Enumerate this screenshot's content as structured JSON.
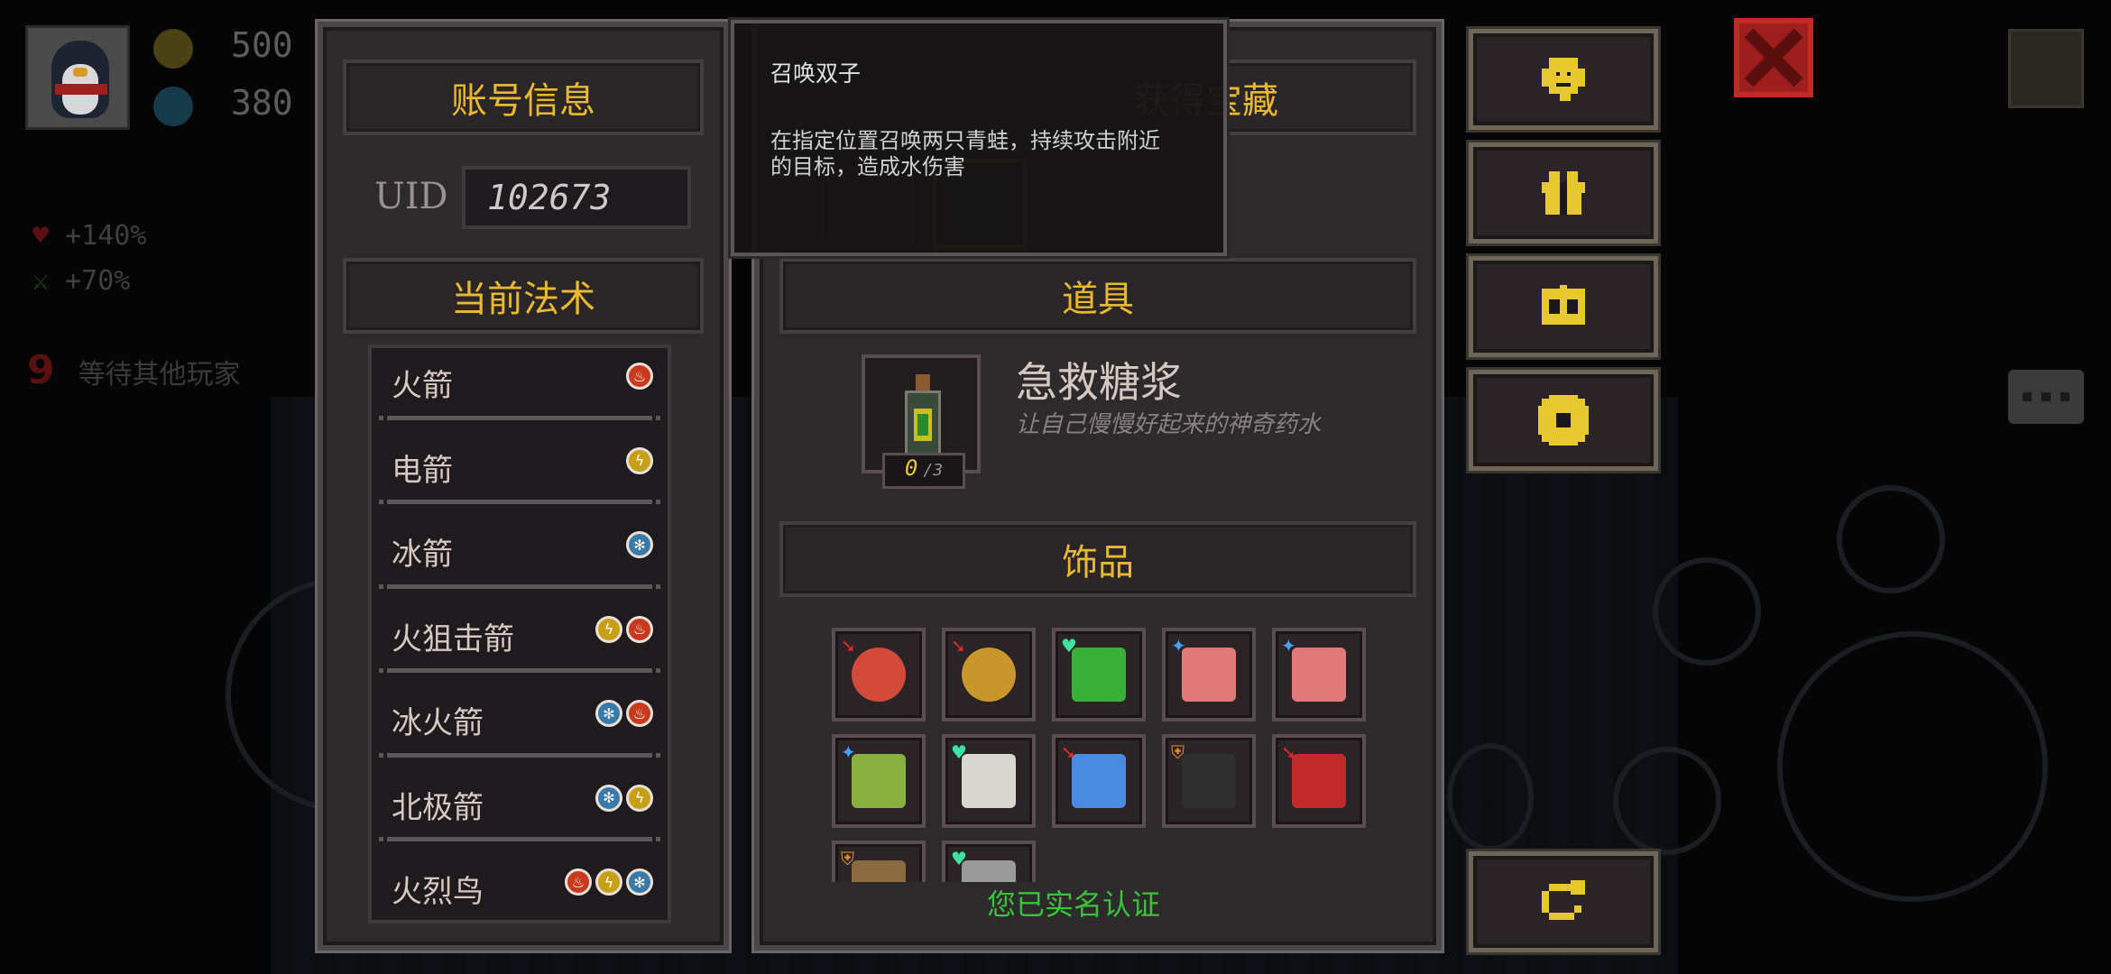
{
  "hud": {
    "coins": "500",
    "gems": "380",
    "hp_bonus": "+140%",
    "atk_bonus": "+70%",
    "wait_count": "9",
    "wait_text": "等待其他玩家"
  },
  "account": {
    "header": "账号信息",
    "uid_label": "UID",
    "uid_value": "102673"
  },
  "spells": {
    "header": "当前法术",
    "items": [
      {
        "name": "火箭",
        "elements": [
          "fire"
        ]
      },
      {
        "name": "电箭",
        "elements": [
          "lightning"
        ]
      },
      {
        "name": "冰箭",
        "elements": [
          "ice"
        ]
      },
      {
        "name": "火狙击箭",
        "elements": [
          "lightning",
          "fire"
        ]
      },
      {
        "name": "冰火箭",
        "elements": [
          "ice",
          "fire"
        ]
      },
      {
        "name": "北极箭",
        "elements": [
          "ice",
          "lightning"
        ]
      },
      {
        "name": "火烈鸟",
        "elements": [
          "fire",
          "lightning",
          "ice"
        ]
      }
    ]
  },
  "treasure": {
    "header": "获得宝藏"
  },
  "tooltip": {
    "title": "召唤双子",
    "description_line1": "在指定位置召唤两只青蛙，持续攻击附近",
    "description_line2": "的目标，造成水伤害"
  },
  "props": {
    "header": "道具",
    "item_name": "急救糖浆",
    "item_desc": "让自己慢慢好起来的神奇药水",
    "count_current": "0",
    "count_max": "/3"
  },
  "accessories": {
    "header": "饰品",
    "items": [
      {
        "icon": "target-shield-icon",
        "badge": "red-arrow",
        "color": "#d24a3a"
      },
      {
        "icon": "gold-coin-icon",
        "badge": "red-arrow",
        "color": "#c8962c"
      },
      {
        "icon": "clover-icon",
        "badge": "green-heart",
        "color": "#3ab03a"
      },
      {
        "icon": "meat-icon",
        "badge": "blue-star",
        "color": "#e07a7a"
      },
      {
        "icon": "meat-icon",
        "badge": "blue-star",
        "color": "#e07a7a"
      },
      {
        "icon": "bottle-icon",
        "badge": "blue-star",
        "color": "#8ab040"
      },
      {
        "icon": "wings-icon",
        "badge": "green-heart",
        "color": "#d8d8d0"
      },
      {
        "icon": "blue-crystal-icon",
        "badge": "red-arrow",
        "color": "#4a8ae0"
      },
      {
        "icon": "black-cat-icon",
        "badge": "orange-shield",
        "color": "#303030"
      },
      {
        "icon": "red-gem-icon",
        "badge": "red-arrow",
        "color": "#c02a2a"
      },
      {
        "icon": "boot-icon",
        "badge": "orange-shield",
        "color": "#8a6a40"
      },
      {
        "icon": "dagger-icon",
        "badge": "green-heart",
        "color": "#9a9a9a"
      }
    ]
  },
  "verified_text": "您已实名认证",
  "side_buttons": [
    "support-icon",
    "gift-icon",
    "shop-icon",
    "settings-icon",
    "refresh-icon"
  ],
  "colors": {
    "accent": "#e8b830",
    "verified": "#3ac23a",
    "close": "#9e1e1e"
  }
}
